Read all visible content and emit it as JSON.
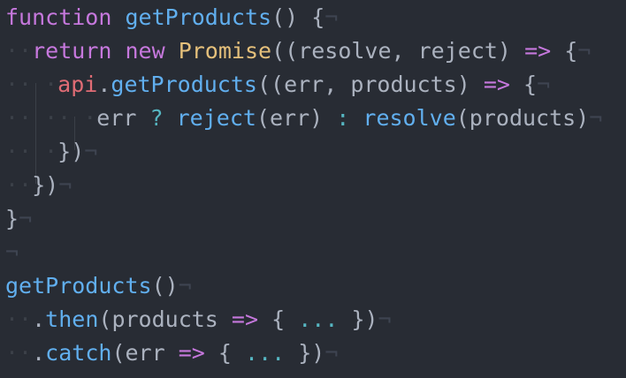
{
  "theme": {
    "background": "#282c34",
    "keyword": "#c678dd",
    "function": "#61afef",
    "class": "#e5c07b",
    "variable": "#e06c75",
    "operator_cyan": "#56b6c2",
    "text": "#abb2bf",
    "invisibles": "#3b4048"
  },
  "invisibles": {
    "space_dot": "·",
    "eol_mark": "¬"
  },
  "code": {
    "l1": {
      "kw_function": "function",
      "sp": " ",
      "fn_name": "getProducts",
      "rest": "() {"
    },
    "l2": {
      "kw_return": "return",
      "kw_new": "new",
      "cls_promise": "Promise",
      "args": "((resolve, reject)",
      "arrow": "=>",
      "brace": "{"
    },
    "l3": {
      "obj": "api",
      "dot": ".",
      "method": "getProducts",
      "args": "((err, products)",
      "arrow": "=>",
      "brace": "{"
    },
    "l4": {
      "err": "err",
      "q": "?",
      "reject": "reject",
      "reject_args": "(err)",
      "colon": ":",
      "resolve": "resolve",
      "resolve_args": "(products)"
    },
    "l5": {
      "text": "})"
    },
    "l6": {
      "text": "})"
    },
    "l7": {
      "text": "}"
    },
    "l9": {
      "fn_name": "getProducts",
      "rest": "()"
    },
    "l10": {
      "dot": ".",
      "then": "then",
      "paren": "(products",
      "arrow": "=>",
      "brace_open": "{",
      "ellipsis": "...",
      "brace_close": "})"
    },
    "l11": {
      "dot": ".",
      "catch": "catch",
      "paren": "(err",
      "arrow": "=>",
      "brace_open": "{",
      "ellipsis": "...",
      "brace_close": "})"
    }
  }
}
